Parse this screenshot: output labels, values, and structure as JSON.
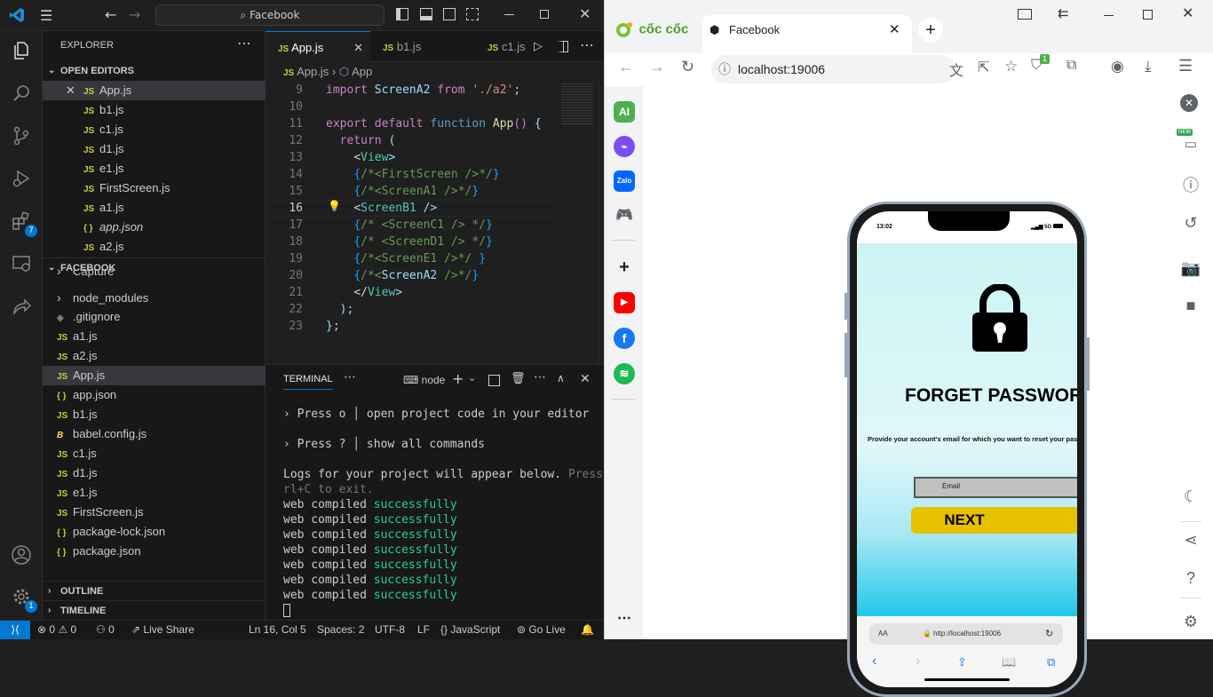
{
  "vscode": {
    "command_center": "Facebook",
    "explorer_title": "EXPLORER",
    "open_editors_title": "OPEN EDITORS",
    "open_editors": [
      {
        "icon": "JS",
        "name": "App.js"
      },
      {
        "icon": "JS",
        "name": "b1.js"
      },
      {
        "icon": "JS",
        "name": "c1.js"
      },
      {
        "icon": "JS",
        "name": "d1.js"
      },
      {
        "icon": "JS",
        "name": "e1.js"
      },
      {
        "icon": "JS",
        "name": "FirstScreen.js"
      },
      {
        "icon": "JS",
        "name": "a1.js"
      },
      {
        "icon": "{ }",
        "name": "app.json"
      },
      {
        "icon": "JS",
        "name": "a2.js"
      }
    ],
    "project_title": "FACEBOOK",
    "project_items": [
      {
        "icon": "›",
        "name": "Capture"
      },
      {
        "icon": "›",
        "name": "node_modules"
      },
      {
        "icon": "◆",
        "name": ".gitignore"
      },
      {
        "icon": "JS",
        "name": "a1.js"
      },
      {
        "icon": "JS",
        "name": "a2.js"
      },
      {
        "icon": "JS",
        "name": "App.js"
      },
      {
        "icon": "{ }",
        "name": "app.json"
      },
      {
        "icon": "JS",
        "name": "b1.js"
      },
      {
        "icon": "B",
        "name": "babel.config.js"
      },
      {
        "icon": "JS",
        "name": "c1.js"
      },
      {
        "icon": "JS",
        "name": "d1.js"
      },
      {
        "icon": "JS",
        "name": "e1.js"
      },
      {
        "icon": "JS",
        "name": "FirstScreen.js"
      },
      {
        "icon": "{ }",
        "name": "package-lock.json"
      },
      {
        "icon": "{ }",
        "name": "package.json"
      }
    ],
    "outline_title": "OUTLINE",
    "timeline_title": "TIMELINE",
    "extensions_badge": "7",
    "accounts_badge": "1",
    "tabs": [
      {
        "icon": "JS",
        "name": "App.js"
      },
      {
        "icon": "JS",
        "name": "b1.js"
      },
      {
        "icon": "JS",
        "name": "c1.js"
      }
    ],
    "breadcrumb": {
      "file": "App.js",
      "symbol": "App"
    },
    "code_lines": [
      {
        "n": "9",
        "text": "import ScreenA2 from './a2';"
      },
      {
        "n": "10",
        "text": ""
      },
      {
        "n": "11",
        "text": "export default function App() {"
      },
      {
        "n": "12",
        "text": "  return ("
      },
      {
        "n": "13",
        "text": "    <View>"
      },
      {
        "n": "14",
        "text": "    {/*<FirstScreen />*/}"
      },
      {
        "n": "15",
        "text": "    {/*<ScreenA1 />*/}"
      },
      {
        "n": "16",
        "text": "    <ScreenB1 />"
      },
      {
        "n": "17",
        "text": "    {/* <ScreenC1 /> */}"
      },
      {
        "n": "18",
        "text": "    {/* <ScreenD1 /> */}"
      },
      {
        "n": "19",
        "text": "    {/*<ScreenE1 />*/ }"
      },
      {
        "n": "20",
        "text": "    {/*<ScreenA2 />*/}"
      },
      {
        "n": "21",
        "text": "    </View>"
      },
      {
        "n": "22",
        "text": "  );"
      },
      {
        "n": "23",
        "text": "};"
      }
    ],
    "terminal_tab": "TERMINAL",
    "terminal_shell": "node",
    "terminal_lines": [
      {
        "a": "› Press o │ open project code in your editor",
        "b": ""
      },
      {
        "a": "",
        "b": ""
      },
      {
        "a": "› Press ? │ show all commands",
        "b": ""
      },
      {
        "a": "",
        "b": ""
      },
      {
        "a": "Logs for your project will appear below. ",
        "b": "Press Ct"
      },
      {
        "a": "",
        "b": "rl+C to exit."
      },
      {
        "a": "web compiled ",
        "c": "successfully"
      },
      {
        "a": "web compiled ",
        "c": "successfully"
      },
      {
        "a": "web compiled ",
        "c": "successfully"
      },
      {
        "a": "web compiled ",
        "c": "successfully"
      },
      {
        "a": "web compiled ",
        "c": "successfully"
      },
      {
        "a": "web compiled ",
        "c": "successfully"
      },
      {
        "a": "web compiled ",
        "c": "successfully"
      }
    ],
    "status": {
      "errors": "0",
      "warnings": "0",
      "ports": "0",
      "live_share": "Live Share",
      "position": "Ln 16, Col 5",
      "spaces": "Spaces: 2",
      "encoding": "UTF-8",
      "eol": "LF",
      "language": "JavaScript",
      "go_live": "Go Live"
    }
  },
  "browser": {
    "brand": "cốc cốc",
    "tab_title": "Facebook",
    "url": "localhost:19006",
    "ext_badge": "1",
    "new_label": "NEW",
    "sidebar_ai": "AI",
    "sidebar_zalo": "Zalo"
  },
  "phone": {
    "time": "13:02",
    "signal": "5G",
    "title": "FORGET PASSWORD",
    "description": "Provide your account's email for which you want to reset your password",
    "email_placeholder": "Email",
    "next_label": "NEXT",
    "safari_aa": "AA",
    "safari_url": "http://localhost:19006"
  },
  "colors": {
    "vscode_accent": "#0078d4",
    "js_icon": "#cbcb41",
    "next_button": "#e5c100",
    "success_text": "#23d18b"
  }
}
